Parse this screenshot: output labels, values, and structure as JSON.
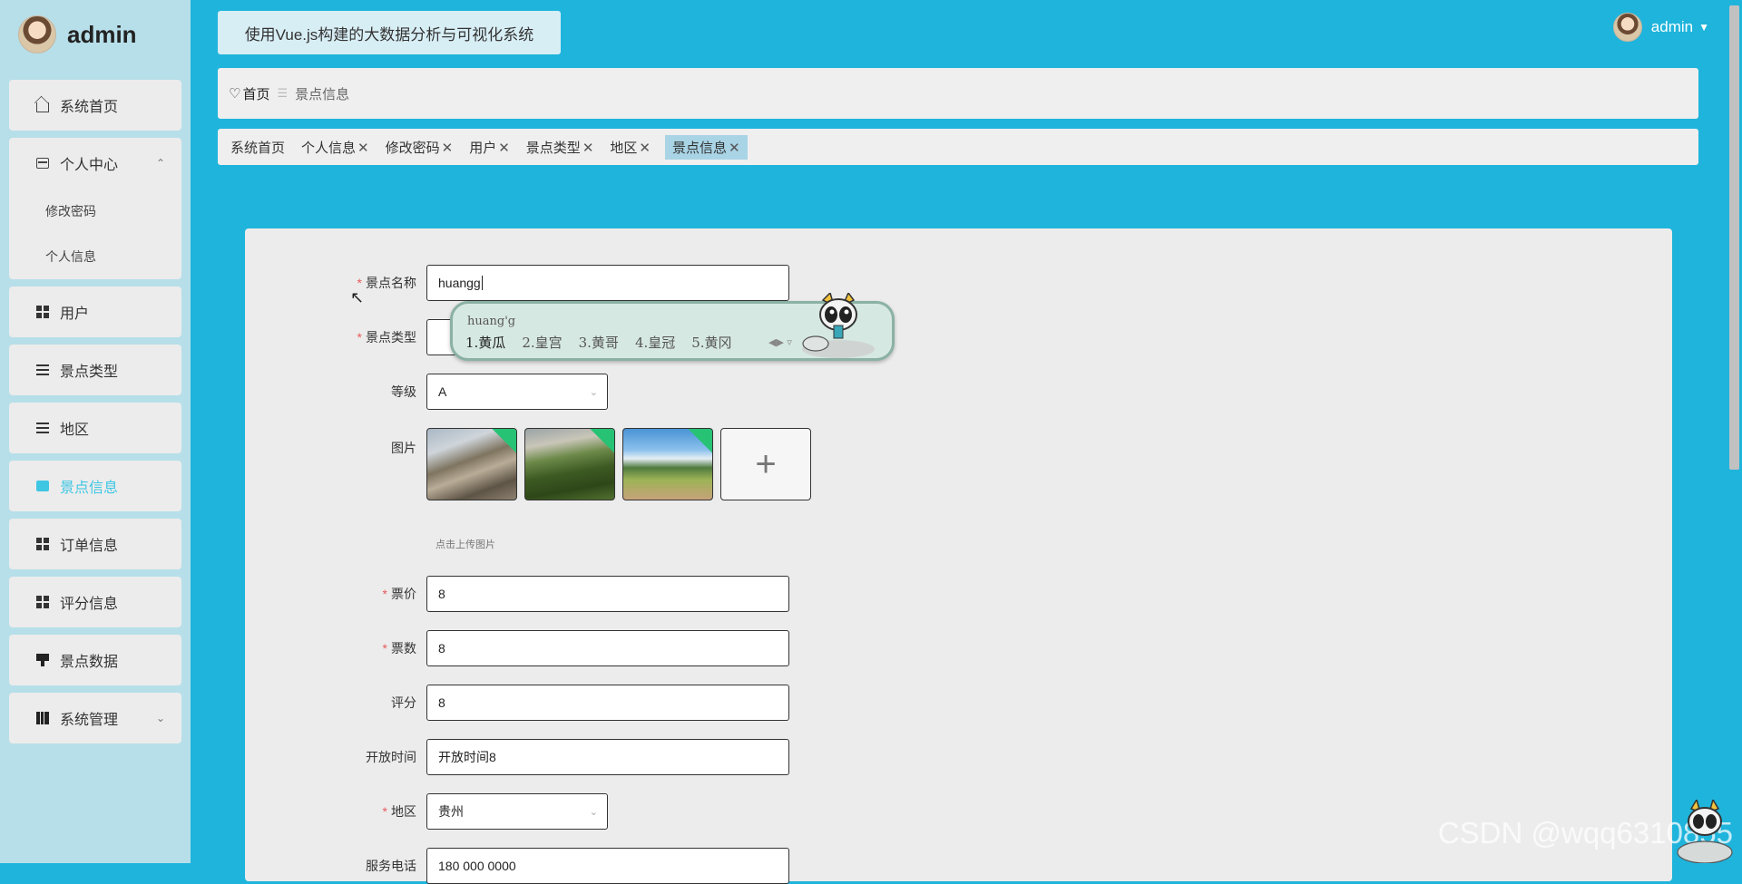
{
  "brand": {
    "name": "admin"
  },
  "header": {
    "system_title": "使用Vue.js构建的大数据分析与可视化系统",
    "user_name": "admin"
  },
  "sidebar": {
    "items": [
      {
        "label": "系统首页",
        "icon": "home-icon"
      },
      {
        "label": "个人中心",
        "icon": "card-icon",
        "expanded": true,
        "children": [
          {
            "label": "修改密码"
          },
          {
            "label": "个人信息"
          }
        ]
      },
      {
        "label": "用户",
        "icon": "grid-icon"
      },
      {
        "label": "景点类型",
        "icon": "list-icon"
      },
      {
        "label": "地区",
        "icon": "list-icon"
      },
      {
        "label": "景点信息",
        "icon": "chart-icon",
        "active": true
      },
      {
        "label": "订单信息",
        "icon": "grid-icon"
      },
      {
        "label": "评分信息",
        "icon": "grid-icon"
      },
      {
        "label": "景点数据",
        "icon": "pin-icon"
      },
      {
        "label": "系统管理",
        "icon": "book-icon"
      }
    ]
  },
  "breadcrumb": {
    "home": "首页",
    "current": "景点信息"
  },
  "tags": [
    {
      "label": "系统首页",
      "closable": false
    },
    {
      "label": "个人信息",
      "closable": true
    },
    {
      "label": "修改密码",
      "closable": true
    },
    {
      "label": "用户",
      "closable": true
    },
    {
      "label": "景点类型",
      "closable": true
    },
    {
      "label": "地区",
      "closable": true
    },
    {
      "label": "景点信息",
      "closable": true,
      "active": true
    }
  ],
  "form": {
    "name": {
      "label": "景点名称",
      "required": true,
      "value": "huangg"
    },
    "type": {
      "label": "景点类型",
      "required": true,
      "value": ""
    },
    "level": {
      "label": "等级",
      "required": false,
      "value": "A"
    },
    "images": {
      "label": "图片",
      "hint": "点击上传图片",
      "upload_icon": "+"
    },
    "price": {
      "label": "票价",
      "required": true,
      "value": "8"
    },
    "tickets": {
      "label": "票数",
      "required": true,
      "value": "8"
    },
    "score": {
      "label": "评分",
      "required": false,
      "value": "8"
    },
    "open_time": {
      "label": "开放时间",
      "required": false,
      "value": "开放时间8"
    },
    "region": {
      "label": "地区",
      "required": true,
      "value": "贵州"
    },
    "phone": {
      "label": "服务电话",
      "required": false,
      "value": "180 000 0000"
    }
  },
  "ime": {
    "composition": "huang'g",
    "candidates": [
      "1.黄瓜",
      "2.皇宫",
      "3.黄哥",
      "4.皇冠",
      "5.黄冈"
    ]
  },
  "watermark": "CSDN @wqq6310855",
  "colors": {
    "background": "#1fb4dc",
    "sidebar": "#b7dfe9",
    "active": "#3fc6e3",
    "required": "#e85a5a"
  }
}
